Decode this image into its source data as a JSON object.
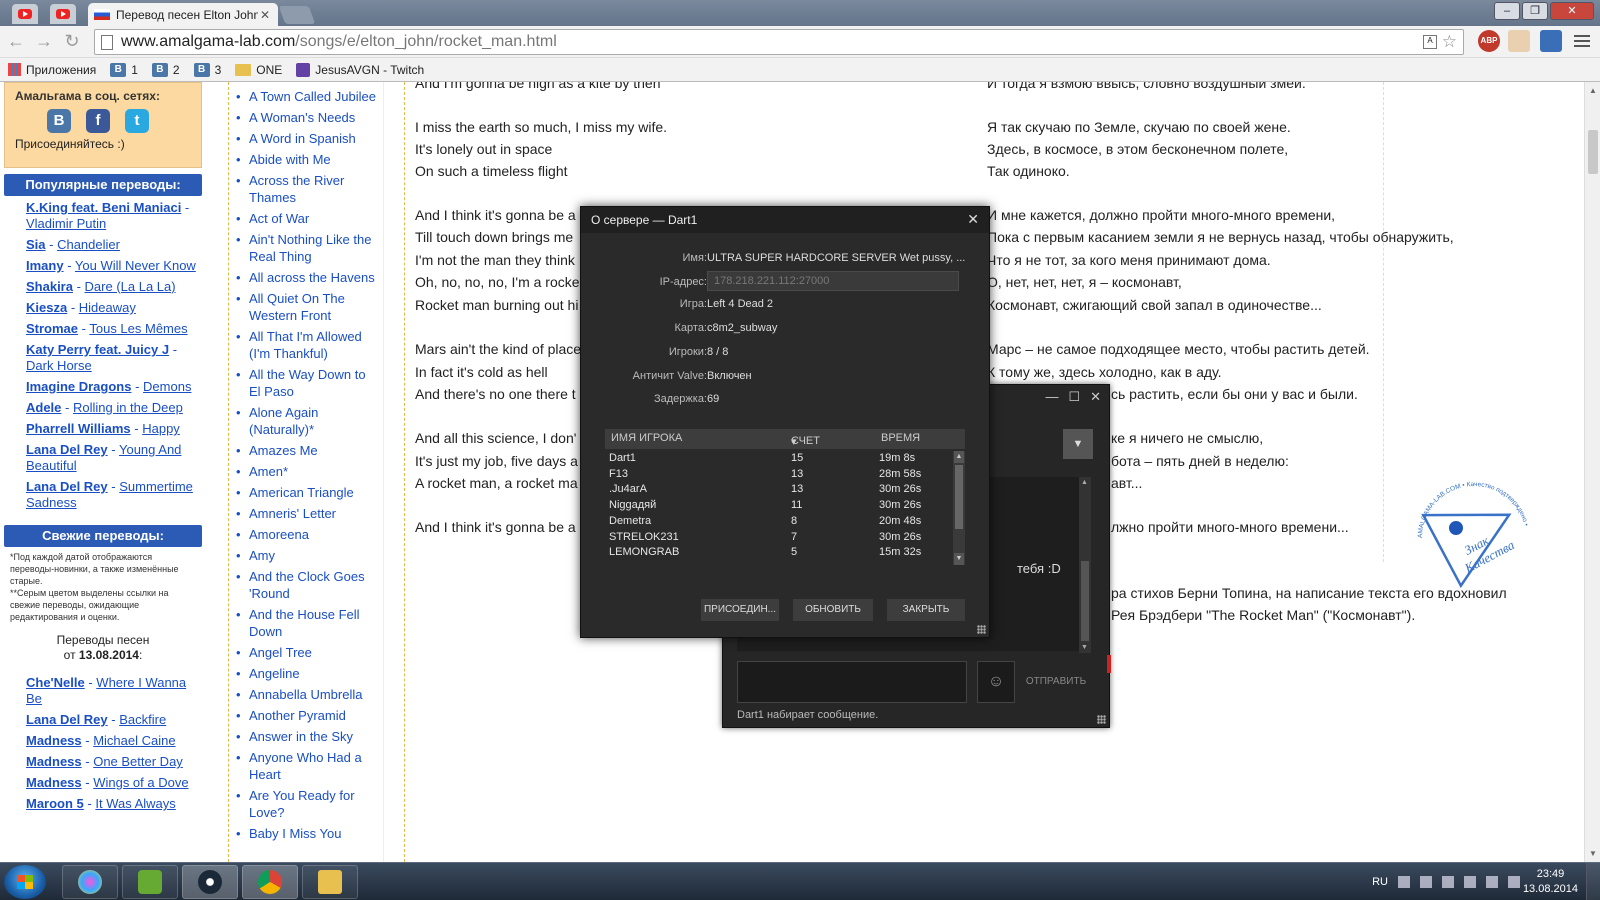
{
  "browser": {
    "tab_title": "Перевод песен Elton John",
    "url_host": "www.amalgama-lab.com",
    "url_path": "/songs/e/elton_john/rocket_man.html",
    "abp_badge": "ABP",
    "bookmarks": [
      {
        "label": "Приложения",
        "icon": "apps-icon"
      },
      {
        "label": "1",
        "icon": "vk-icon"
      },
      {
        "label": "2",
        "icon": "vk-icon"
      },
      {
        "label": "3",
        "icon": "vk-icon"
      },
      {
        "label": "ONE",
        "icon": "folder-icon"
      },
      {
        "label": "JesusAVGN - Twitch",
        "icon": "twitch-icon"
      }
    ]
  },
  "sidebar": {
    "social_title": "Амальгама в соц. сетях:",
    "social_join": "Присоединяйтесь :)",
    "popular_title": "Популярные переводы:",
    "popular": [
      {
        "artist": "K.King feat. Beni Maniaci",
        "song": "Vladimir Putin"
      },
      {
        "artist": "Sia",
        "song": "Chandelier"
      },
      {
        "artist": "Imany",
        "song": "You Will Never Know"
      },
      {
        "artist": "Shakira",
        "song": "Dare (La La La)"
      },
      {
        "artist": "Kiesza",
        "song": "Hideaway"
      },
      {
        "artist": "Stromae",
        "song": "Tous Les Mêmes"
      },
      {
        "artist": "Katy Perry feat. Juicy J",
        "song": "Dark Horse"
      },
      {
        "artist": "Imagine Dragons",
        "song": "Demons"
      },
      {
        "artist": "Adele",
        "song": "Rolling in the Deep"
      },
      {
        "artist": "Pharrell Williams",
        "song": "Happy"
      },
      {
        "artist": "Lana Del Rey",
        "song": "Young And Beautiful"
      },
      {
        "artist": "Lana Del Rey",
        "song": "Summertime Sadness"
      }
    ],
    "fresh_title": "Свежие переводы:",
    "fresh_note1": "*Под каждой датой отображаются переводы-новинки, а также изменённые старые.",
    "fresh_note2": "**Серым цветом выделены ссылки на свежие переводы, ожидающие редактирования и оценки.",
    "fresh_date_label": "Переводы песен",
    "fresh_date_prefix": "от",
    "fresh_date": "13.08.2014",
    "fresh": [
      {
        "artist": "Che'Nelle",
        "song": "Where I Wanna Be"
      },
      {
        "artist": "Lana Del Rey",
        "song": "Backfire"
      },
      {
        "artist": "Madness",
        "song": "Michael Caine"
      },
      {
        "artist": "Madness",
        "song": "One Better Day"
      },
      {
        "artist": "Madness",
        "song": "Wings of a Dove"
      },
      {
        "artist": "Maroon 5",
        "song": "It Was Always"
      }
    ]
  },
  "songs": [
    "A Town Called Jubilee",
    "A Woman's Needs",
    "A Word in Spanish",
    "Abide with Me",
    "Across the River Thames",
    "Act of War",
    "Ain't Nothing Like the Real Thing",
    "All across the Havens",
    "All Quiet On The Western Front",
    "All That I'm Allowed (I'm Thankful)",
    "All the Way Down to El Paso",
    "Alone Again (Naturally)*",
    "Amazes Me",
    "Amen*",
    "American Triangle",
    "Amneris' Letter",
    "Amoreena",
    "Amy",
    "And the Clock Goes 'Round",
    "And the House Fell Down",
    "Angel Tree",
    "Angeline",
    "Annabella Umbrella",
    "Another Pyramid",
    "Answer in the Sky",
    "Anyone Who Had a Heart",
    "Are You Ready for Love?",
    "Baby I Miss You"
  ],
  "lyrics": {
    "left": [
      "And I'm gonna be high as a kite by then",
      "I miss the earth so much, I miss my wife.",
      "It's lonely out in space",
      "On such a timeless flight",
      "And I think it's gonna be a",
      "Till touch down brings me",
      "I'm not the man they think",
      "Oh, no, no, no, I'm a rocke",
      "Rocket man burning out hi",
      "Mars ain't the kind of place",
      "In fact it's cold as hell",
      "And there's no one there t",
      "And all this science, I don'",
      "It's just my job, five days a",
      "A rocket man, a rocket ma",
      "And I think it's gonna be a"
    ],
    "right": [
      "И тогда я взмою ввысь, словно воздушный змей.",
      "Я так скучаю по Земле, скучаю по своей жене.",
      "Здесь, в космосе, в этом бесконечном полете,",
      "Так одиноко.",
      "И мне кажется, должно пройти много-много времени,",
      "Пока с первым касанием земли я не вернусь назад, чтобы обнаружить,",
      "Что я не тот, за кого меня принимают дома.",
      "О, нет, нет, нет, я – космонавт,",
      "Космонавт, сжигающий свой запал в одиночестве...",
      "Марс – не самое подходящее место, чтобы растить детей.",
      "К тому же, здесь холодно, как в аду.",
      "сь растить, если бы они у вас и были.",
      "ке я ничего не смыслю,",
      "бота – пять дней в неделю:",
      "авт...",
      "лжно пройти много-много времени..."
    ],
    "note_line1": "ра стихов Берни Топина, на написание текста его вдохновил",
    "note_line2": "Рея Брэдбери \"The Rocket Man\" (\"Космонавт\")."
  },
  "stamp": {
    "text1": "Знак",
    "text2": "Качества",
    "ring": "AMALGAMA-LAB.COM • Качество подтверждено •"
  },
  "server_dialog": {
    "title": "О сервере — Dart1",
    "fields": [
      {
        "key": "Имя:",
        "value": "ULTRA SUPER HARDCORE SERVER Wet pussy, ..."
      },
      {
        "key": "IP-адрес:",
        "value": "178.218.221.112:27000"
      },
      {
        "key": "Игра:",
        "value": "Left 4 Dead 2"
      },
      {
        "key": "Карта:",
        "value": "c8m2_subway"
      },
      {
        "key": "Игроки:",
        "value": "8 / 8"
      },
      {
        "key": "Античит Valve:",
        "value": "Включен"
      },
      {
        "key": "Задержка:",
        "value": "69"
      }
    ],
    "columns": [
      "ИМЯ ИГРОКА",
      "СЧЕТ",
      "ВРЕМЯ"
    ],
    "players": [
      {
        "name": "Dart1",
        "score": "15",
        "time": "19m 8s"
      },
      {
        "name": "F13",
        "score": "13",
        "time": "28m 58s"
      },
      {
        "name": ".Ju4arA",
        "score": "13",
        "time": "30m 26s"
      },
      {
        "name": "Niggадяй",
        "score": "11",
        "time": "30m 26s"
      },
      {
        "name": "Demetra",
        "score": "8",
        "time": "20m 48s"
      },
      {
        "name": "STRELOK231",
        "score": "7",
        "time": "30m 26s"
      },
      {
        "name": "LEMONGRAB",
        "score": "5",
        "time": "15m 32s"
      }
    ],
    "buttons": {
      "join": "ПРИСОЕДИН...",
      "refresh": "ОБНОВИТЬ",
      "close": "ЗАКРЫТЬ"
    }
  },
  "chat_window": {
    "message_fragment": "тебя :D",
    "send": "ОТПРАВИТЬ",
    "typing": "Dart1 набирает сообщение."
  },
  "taskbar": {
    "lang": "RU",
    "time": "23:49",
    "date": "13.08.2014"
  }
}
